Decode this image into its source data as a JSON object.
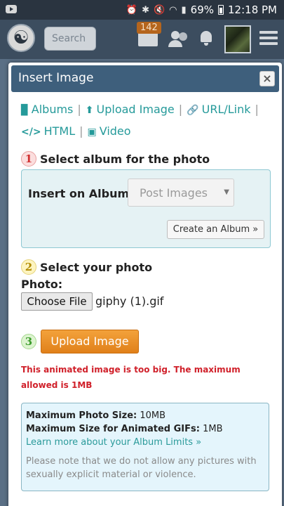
{
  "status_bar": {
    "battery": "69%",
    "time": "12:18 PM"
  },
  "header": {
    "search_placeholder": "Search",
    "message_count": "142"
  },
  "modal": {
    "title": "Insert Image",
    "close_label": "×",
    "tabs": [
      {
        "icon": "albums-icon",
        "label": "Albums"
      },
      {
        "icon": "upload-icon",
        "label": "Upload Image"
      },
      {
        "icon": "link-icon",
        "label": "URL/Link"
      },
      {
        "icon": "code-icon",
        "label": "HTML"
      },
      {
        "icon": "video-icon",
        "label": "Video"
      }
    ],
    "step1": {
      "number": "1",
      "title": "Select album for the photo",
      "album_label": "Insert on Album:",
      "album_selected": "Post Images",
      "create_album_label": "Create an Album »"
    },
    "step2": {
      "number": "2",
      "title": "Select your photo",
      "photo_label": "Photo:",
      "choose_file_label": "Choose File",
      "file_name": "giphy (1).gif"
    },
    "step3": {
      "number": "3",
      "upload_label": "Upload Image"
    },
    "error_message": "This animated image is too big. The maximum allowed is 1MB",
    "info": {
      "max_photo_label": "Maximum Photo Size:",
      "max_photo_value": "10MB",
      "max_gif_label": "Maximum Size for Animated GIFs:",
      "max_gif_value": "1MB",
      "learn_more": "Learn more about your Album Limits »",
      "note": "Please note that we do not allow any pictures with sexually explicit material or violence."
    }
  },
  "colors": {
    "header_bg": "#3c4d5f",
    "modal_title_bg": "#3e5f7c",
    "link": "#259a9a",
    "upload_button": "#e8901f",
    "error": "#d0202a",
    "info_bg": "#e4f5fc",
    "album_bg": "#e5f2f4"
  }
}
